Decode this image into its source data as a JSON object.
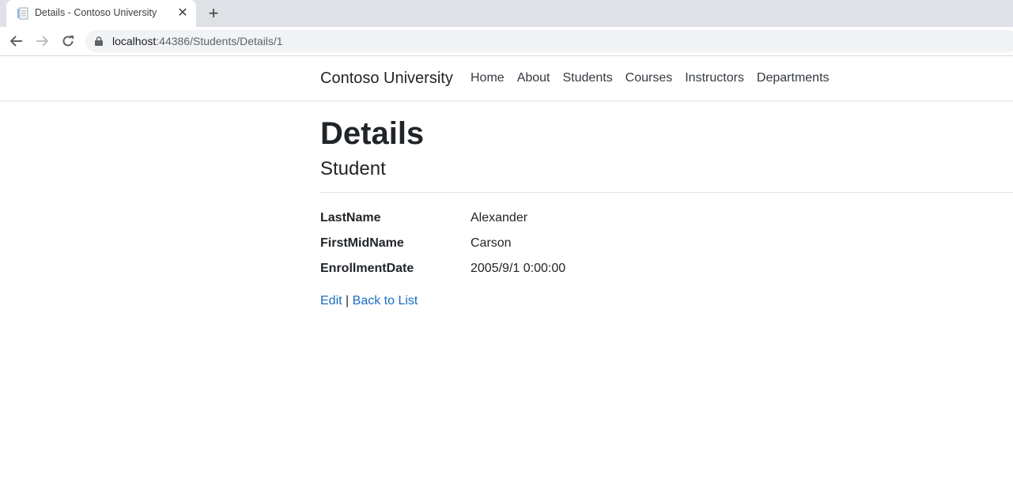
{
  "browser": {
    "tab_title": "Details - Contoso University",
    "url_host": "localhost",
    "url_path": ":44386/Students/Details/1"
  },
  "navbar": {
    "brand": "Contoso University",
    "links": [
      "Home",
      "About",
      "Students",
      "Courses",
      "Instructors",
      "Departments"
    ]
  },
  "page": {
    "title": "Details",
    "subtitle": "Student",
    "fields": [
      {
        "label": "LastName",
        "value": "Alexander"
      },
      {
        "label": "FirstMidName",
        "value": "Carson"
      },
      {
        "label": "EnrollmentDate",
        "value": "2005/9/1 0:00:00"
      }
    ],
    "actions": {
      "edit": "Edit",
      "separator": "|",
      "back": "Back to List"
    }
  },
  "colors": {
    "link": "#1b6ec2",
    "text": "#212529",
    "tabstrip": "#dee1e6"
  }
}
